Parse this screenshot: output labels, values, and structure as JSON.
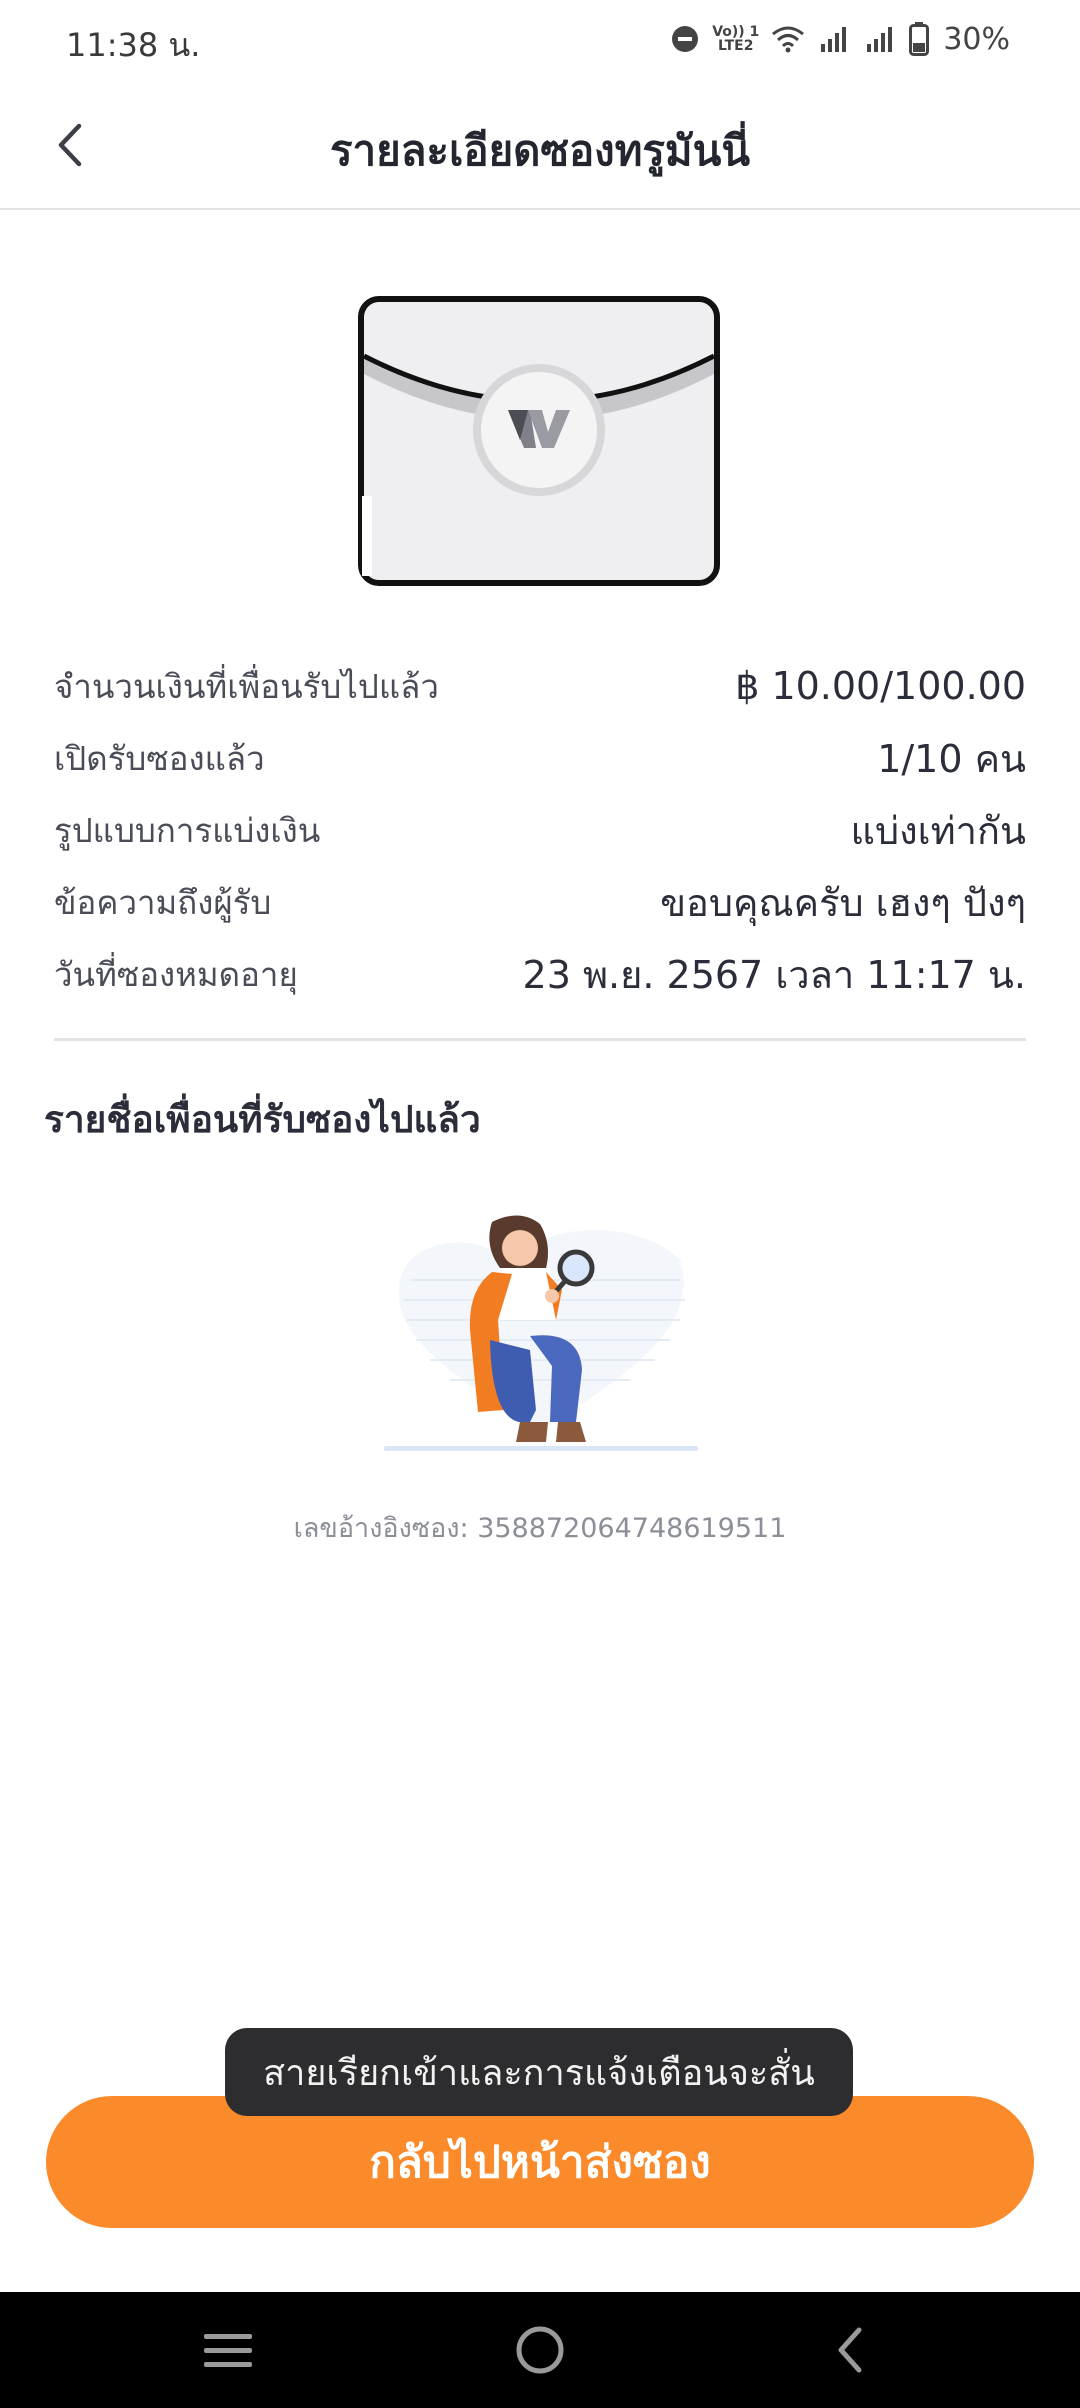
{
  "status_bar": {
    "time": "11:38 น.",
    "lte_top": "Vo)) 1",
    "lte_bottom": "LTE2",
    "battery": "30%"
  },
  "header": {
    "title": "รายละเอียดซองทรูมันนี่"
  },
  "details": {
    "rows": [
      {
        "label": "จำนวนเงินที่เพื่อนรับไปแล้ว",
        "value": "฿ 10.00/100.00"
      },
      {
        "label": "เปิดรับซองแล้ว",
        "value": "1/10 คน"
      },
      {
        "label": "รูปแบบการแบ่งเงิน",
        "value": "แบ่งเท่ากัน"
      },
      {
        "label": "ข้อความถึงผู้รับ",
        "value": "ขอบคุณครับ เฮงๆ ปังๆ"
      },
      {
        "label": "วันที่ซองหมดอายุ",
        "value": "23 พ.ย. 2567 เวลา 11:17 น."
      }
    ]
  },
  "receivers": {
    "section_title": "รายชื่อเพื่อนที่รับซองไปแล้ว",
    "reference": "เลขอ้างอิงซอง: 358872064748619511"
  },
  "toast": {
    "text": "สายเรียกเข้าและการแจ้งเตือนจะสั่น"
  },
  "actions": {
    "back_to_send_label": "กลับไปหน้าส่งซอง"
  },
  "colors": {
    "accent": "#fb8a2a",
    "text": "#2b2e3a",
    "muted": "#8c8f98"
  },
  "icons": {
    "back": "chevron-left-icon",
    "nav_recent": "menu-lines-icon",
    "nav_home": "circle-home-icon",
    "nav_back": "chevron-left-icon"
  }
}
